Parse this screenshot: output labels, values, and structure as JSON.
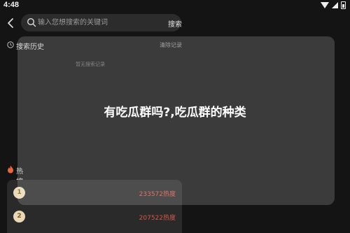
{
  "status_bar": {
    "time": "4:48"
  },
  "search": {
    "placeholder": "输入您想搜索的关键词",
    "button_label": "搜索"
  },
  "history": {
    "title": "搜索历史",
    "clear_label": "清除记录",
    "empty_text": "暂无搜索记录"
  },
  "hot": {
    "title": "热搜总榜",
    "items": [
      {
        "rank": "1",
        "heat": "233572热度"
      },
      {
        "rank": "2",
        "heat": "207522热度"
      }
    ]
  },
  "overlay": {
    "title": "有吃瓜群吗?,吃瓜群的种类"
  },
  "colors": {
    "background": "#141414",
    "accent": "#d8574a",
    "rank_badge": "#e9d9b6"
  },
  "icons": [
    "back-icon",
    "search-icon",
    "clock-icon",
    "fire-icon",
    "wifi-icon",
    "signal-icon",
    "battery-icon"
  ]
}
